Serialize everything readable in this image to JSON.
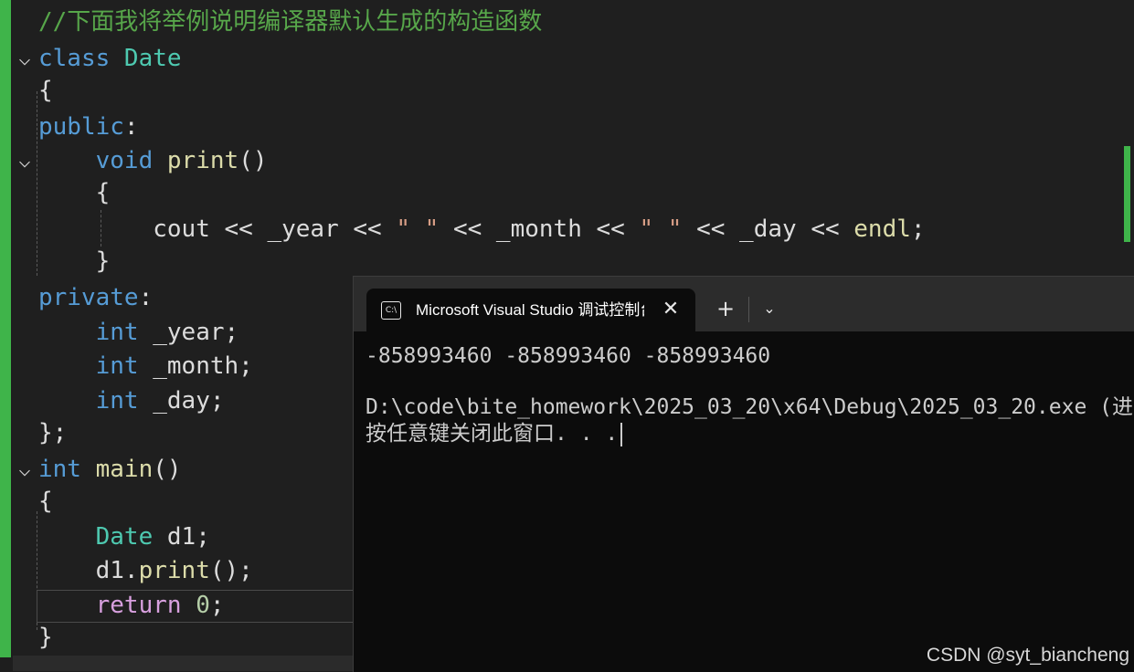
{
  "editor": {
    "lines": [
      {
        "id": "comment",
        "segments": [
          {
            "c": "cmt",
            "t": "//下面我将举例说明编译器默认生成的构造函数"
          }
        ]
      },
      {
        "id": "class-decl",
        "segments": [
          {
            "c": "kw",
            "t": "class "
          },
          {
            "c": "type",
            "t": "Date"
          }
        ]
      },
      {
        "id": "class-open",
        "segments": [
          {
            "c": "plain",
            "t": "{"
          }
        ]
      },
      {
        "id": "public",
        "segments": [
          {
            "c": "kw",
            "t": "public"
          },
          {
            "c": "plain",
            "t": ":"
          }
        ]
      },
      {
        "id": "print-decl",
        "segments": [
          {
            "c": "plain",
            "t": "    "
          },
          {
            "c": "kw",
            "t": "void "
          },
          {
            "c": "fn",
            "t": "print"
          },
          {
            "c": "plain",
            "t": "()"
          }
        ]
      },
      {
        "id": "print-open",
        "segments": [
          {
            "c": "plain",
            "t": "    {"
          }
        ]
      },
      {
        "id": "cout-line",
        "segments": [
          {
            "c": "plain",
            "t": "        "
          },
          {
            "c": "plain",
            "t": "cout << _year << "
          },
          {
            "c": "str",
            "t": "\" \""
          },
          {
            "c": "plain",
            "t": " << _month << "
          },
          {
            "c": "str",
            "t": "\" \""
          },
          {
            "c": "plain",
            "t": " << _day << "
          },
          {
            "c": "fn",
            "t": "endl"
          },
          {
            "c": "plain",
            "t": ";"
          }
        ]
      },
      {
        "id": "print-close",
        "segments": [
          {
            "c": "plain",
            "t": "    }"
          }
        ]
      },
      {
        "id": "private",
        "segments": [
          {
            "c": "kw",
            "t": "private"
          },
          {
            "c": "plain",
            "t": ":"
          }
        ]
      },
      {
        "id": "member-year",
        "segments": [
          {
            "c": "plain",
            "t": "    "
          },
          {
            "c": "kw",
            "t": "int "
          },
          {
            "c": "plain",
            "t": "_year;"
          }
        ]
      },
      {
        "id": "member-month",
        "segments": [
          {
            "c": "plain",
            "t": "    "
          },
          {
            "c": "kw",
            "t": "int "
          },
          {
            "c": "plain",
            "t": "_month;"
          }
        ]
      },
      {
        "id": "member-day",
        "segments": [
          {
            "c": "plain",
            "t": "    "
          },
          {
            "c": "kw",
            "t": "int "
          },
          {
            "c": "plain",
            "t": "_day;"
          }
        ]
      },
      {
        "id": "class-close",
        "segments": [
          {
            "c": "plain",
            "t": "};"
          }
        ]
      },
      {
        "id": "main-decl",
        "segments": [
          {
            "c": "kw",
            "t": "int "
          },
          {
            "c": "fn",
            "t": "main"
          },
          {
            "c": "plain",
            "t": "()"
          }
        ]
      },
      {
        "id": "main-open",
        "segments": [
          {
            "c": "plain",
            "t": "{"
          }
        ]
      },
      {
        "id": "date-decl",
        "segments": [
          {
            "c": "plain",
            "t": "    "
          },
          {
            "c": "type",
            "t": "Date "
          },
          {
            "c": "plain",
            "t": "d1;"
          }
        ]
      },
      {
        "id": "print-call",
        "segments": [
          {
            "c": "plain",
            "t": "    d1."
          },
          {
            "c": "fn",
            "t": "print"
          },
          {
            "c": "plain",
            "t": "();"
          }
        ]
      },
      {
        "id": "return",
        "segments": [
          {
            "c": "plain",
            "t": "    "
          },
          {
            "c": "ctl",
            "t": "return "
          },
          {
            "c": "num",
            "t": "0"
          },
          {
            "c": "plain",
            "t": ";"
          }
        ]
      },
      {
        "id": "main-close",
        "segments": [
          {
            "c": "plain",
            "t": "}"
          }
        ]
      }
    ]
  },
  "console": {
    "tab_title": "Microsoft Visual Studio 调试控制台",
    "tab_icon_text": "C:\\",
    "close_glyph": "✕",
    "new_tab_glyph": "+",
    "dropdown_glyph": "⌄",
    "output": {
      "line1": "-858993460 -858993460 -858993460",
      "line2": "D:\\code\\bite_homework\\2025_03_20\\x64\\Debug\\2025_03_20.exe (进",
      "line3": "按任意键关闭此窗口. . ."
    }
  },
  "watermark": "CSDN @syt_biancheng"
}
